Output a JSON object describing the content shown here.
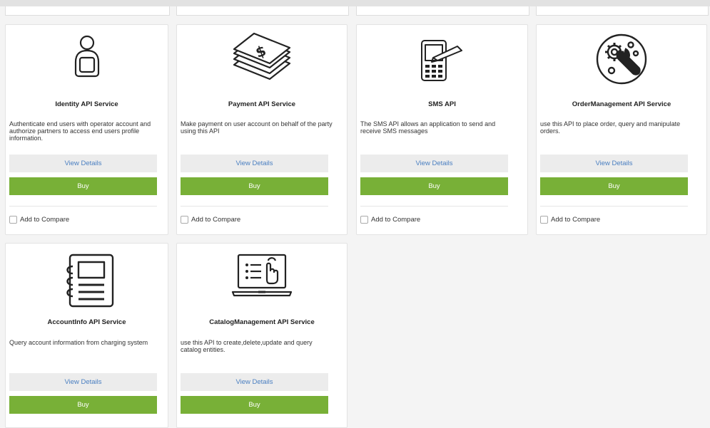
{
  "cards": [
    {
      "title": "Identity API Service",
      "icon": "user-tablet-icon",
      "description": "Authenticate end users with operator account and authorize partners to access end users profile information.",
      "view_label": "View Details",
      "buy_label": "Buy",
      "compare_label": "Add to Compare"
    },
    {
      "title": "Payment API Service",
      "icon": "money-stack-icon",
      "description": "Make payment on user account on behalf of the party using this API",
      "view_label": "View Details",
      "buy_label": "Buy",
      "compare_label": "Add to Compare"
    },
    {
      "title": "SMS API",
      "icon": "phone-pen-icon",
      "description": "The SMS API allows an application to send and receive SMS messages",
      "view_label": "View Details",
      "buy_label": "Buy",
      "compare_label": "Add to Compare"
    },
    {
      "title": "OrderManagement API Service",
      "icon": "gears-wrench-icon",
      "description": "use this API to place order, query and manipulate orders.",
      "view_label": "View Details",
      "buy_label": "Buy",
      "compare_label": "Add to Compare"
    },
    {
      "title": "AccountInfo API Service",
      "icon": "notebook-icon",
      "description": "Query account information from charging system",
      "view_label": "View Details",
      "buy_label": "Buy"
    },
    {
      "title": "CatalogManagement API Service",
      "icon": "laptop-catalog-icon",
      "description": "use this API to create,delete,update and query catalog entities.",
      "view_label": "View Details",
      "buy_label": "Buy"
    }
  ],
  "colors": {
    "buy_button": "#78b037",
    "view_button_bg": "#ececec",
    "view_button_text": "#4a7fc1"
  }
}
